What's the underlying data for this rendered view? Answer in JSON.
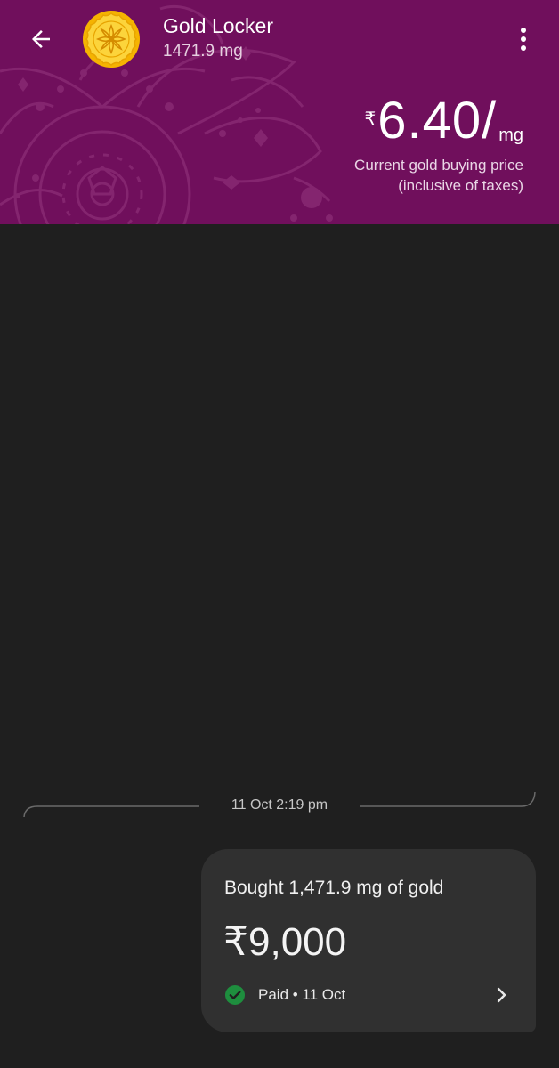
{
  "header": {
    "title": "Gold Locker",
    "balance": "1471.9 mg",
    "back_icon": "arrow-back-icon",
    "more_icon": "more-vert-icon",
    "coin_icon": "gold-coin-icon",
    "background_color": "#700f5c"
  },
  "price": {
    "currency": "₹",
    "value": "6.40/",
    "unit": "mg",
    "caption_line1": "Current gold buying price",
    "caption_line2": "(inclusive of taxes)"
  },
  "timeline": {
    "date_time": "11 Oct 2:19 pm"
  },
  "transaction": {
    "description": "Bought 1,471.9 mg of gold",
    "amount": "₹9,000",
    "status": "Paid • 11 Oct",
    "status_icon": "check-circle-icon",
    "status_color": "#1e8e3e",
    "chevron_icon": "chevron-right-icon"
  }
}
